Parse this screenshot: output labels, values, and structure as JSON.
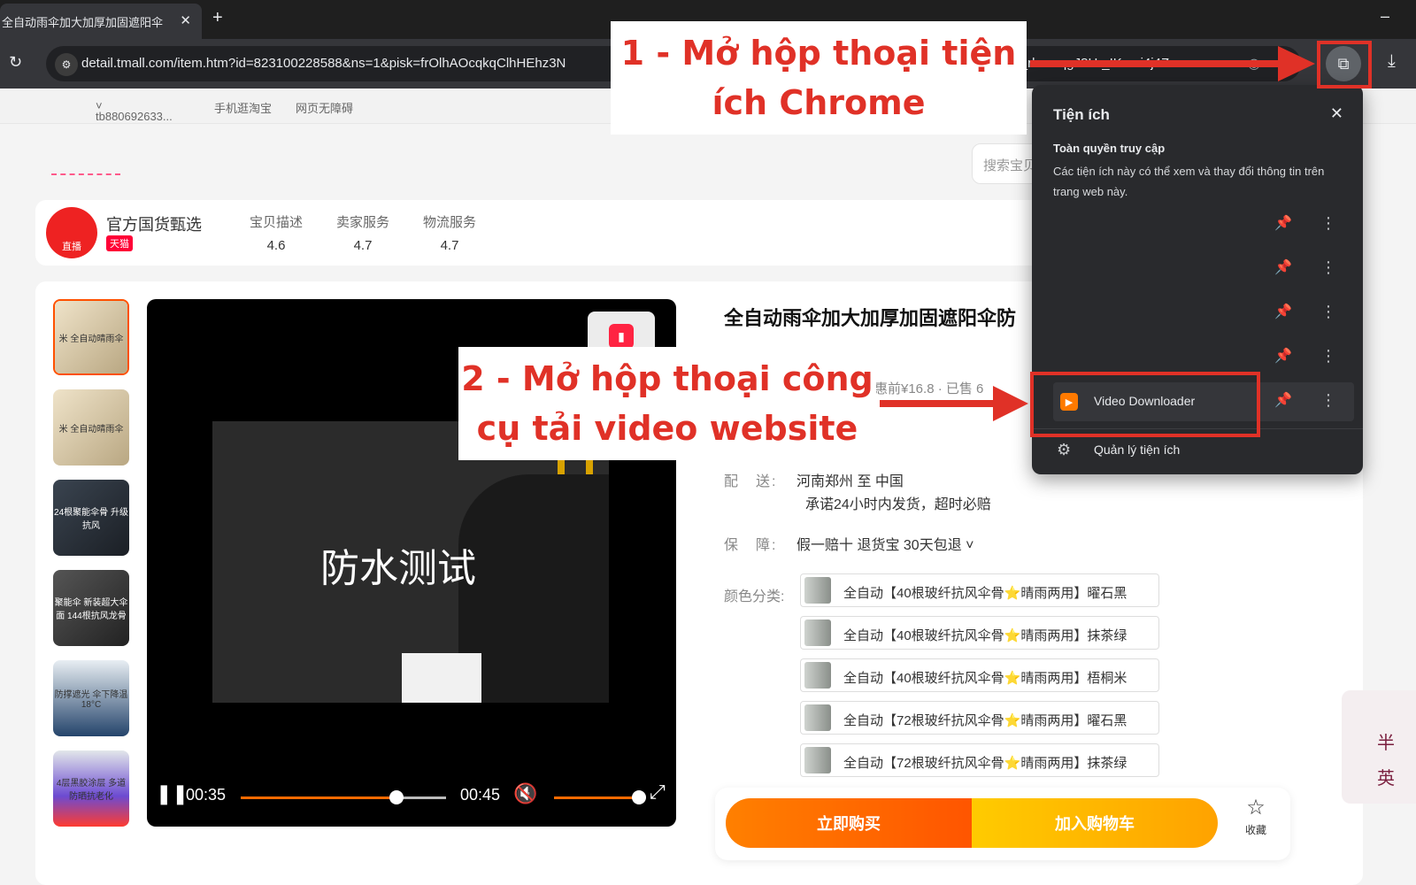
{
  "browser": {
    "tab_title": "全自动雨伞加大加厚加固遮阳伞",
    "tab_close": "✕",
    "new_tab": "+",
    "url": "detail.tmall.com/item.htm?id=823100228588&ns=1&pisk=frOlhAOcqkqClhHEhz3N",
    "url_tail": "LgSFv_rkcvoqgJ8H-_IKomi4j4Z..."
  },
  "site_top": {
    "user": "tb880692633...",
    "mobile": "手机逛淘宝",
    "accessible": "网页无障碍"
  },
  "search": {
    "placeholder": "搜索宝贝"
  },
  "shop": {
    "name": "官方国货甄选",
    "badge": "天猫",
    "logo_text": "直播",
    "scores": [
      {
        "label": "宝贝描述",
        "value": "4.6"
      },
      {
        "label": "卖家服务",
        "value": "4.7"
      },
      {
        "label": "物流服务",
        "value": "4.7"
      }
    ]
  },
  "thumbs": [
    "米 全自动晴雨伞",
    "米 全自动晴雨伞",
    "24根聚能伞骨 升级抗风",
    "聚能伞 新装超大伞面 144根抗风龙骨",
    "防撑遮光 伞下降温18°C",
    "4层黑胶涂层 多道防晒抗老化"
  ],
  "video": {
    "overlay_text": "防水测试",
    "current_time": "00:35",
    "total_time": "00:45",
    "progress": 0.76,
    "volume": 1.0
  },
  "product": {
    "title": "全自动雨伞加大加厚加固遮阳伞防",
    "price_line": "惠前¥16.8 · 已售 6",
    "ship_label": "配　送:",
    "ship_value": "河南郑州  至  中国",
    "ship_note": "承诺24小时内发货，超时必赔",
    "guarantee_label": "保　障:",
    "guarantee_value": "假一赔十 退货宝 30天包退 ˅",
    "color_label": "颜色分类:",
    "skus": [
      "全自动【40根玻纤抗风伞骨⭐晴雨两用】曜石黑",
      "全自动【40根玻纤抗风伞骨⭐晴雨两用】抹茶绿",
      "全自动【40根玻纤抗风伞骨⭐晴雨两用】梧桐米",
      "全自动【72根玻纤抗风伞骨⭐晴雨两用】曜石黑",
      "全自动【72根玻纤抗风伞骨⭐晴雨两用】抹茶绿"
    ]
  },
  "buy_bar": {
    "buy_now": "立即购买",
    "add_cart": "加入购物车",
    "favorite": "收藏"
  },
  "side_ad": {
    "text": "半 英"
  },
  "extensions_popup": {
    "title": "Tiện ích",
    "section_title": "Toàn quyền truy cập",
    "section_desc": "Các tiện ích này có thể xem và thay đổi thông tin trên trang web này.",
    "highlighted_extension": "Video Downloader",
    "manage": "Quản lý tiện ích"
  },
  "annotations": {
    "step1": "1 - Mở hộp thoại tiện ích Chrome",
    "step2": "2 - Mở hộp thoại công cụ tải video website",
    "color": "#e03127"
  }
}
